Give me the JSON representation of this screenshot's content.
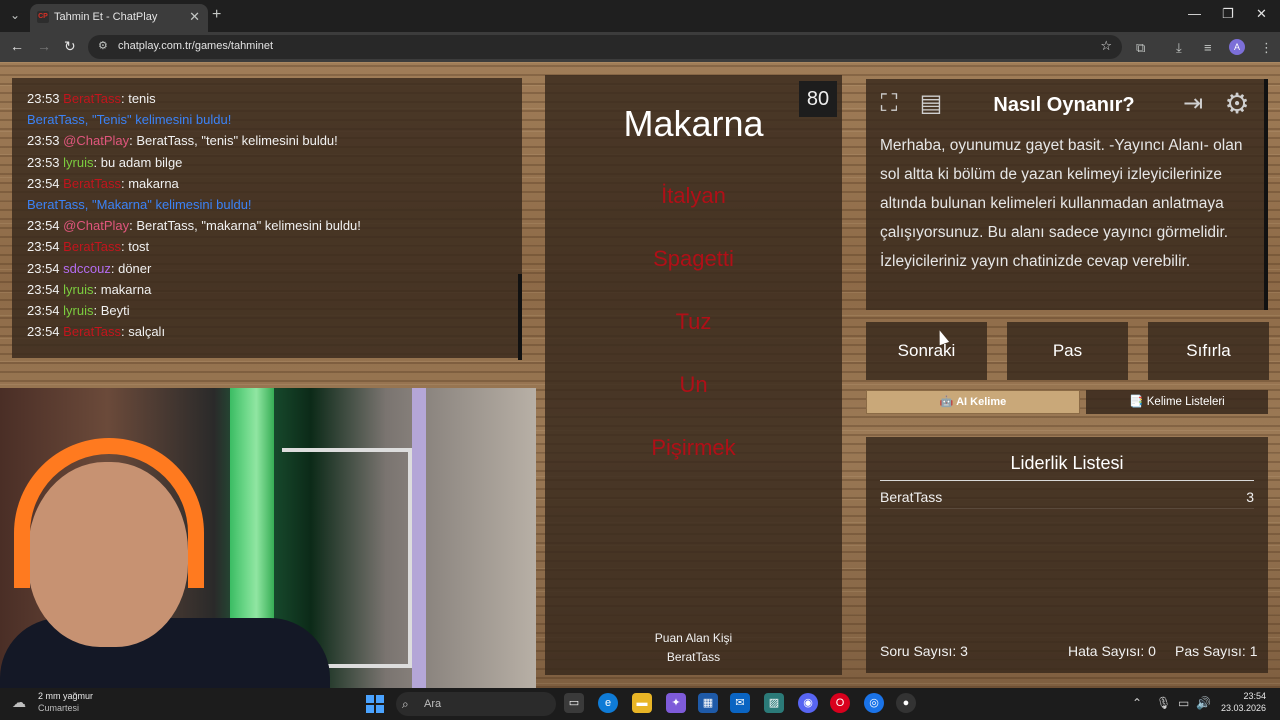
{
  "browser": {
    "tab_title": "Tahmin Et - ChatPlay",
    "tab_favicon": "CP",
    "url": "chatplay.com.tr/games/tahminet",
    "profile_initial": "A",
    "icons": [
      "tab-search-icon",
      "close-icon",
      "new-tab-icon",
      "minimize-icon",
      "maximize-icon",
      "window-close-icon",
      "back-icon",
      "forward-icon",
      "reload-icon",
      "site-info-icon",
      "bookmark-star-icon",
      "extensions-icon",
      "download-icon",
      "media-icon",
      "menu-icon"
    ]
  },
  "chat": {
    "messages": [
      {
        "time": "23:53",
        "user": "BeratTass",
        "user_color": "#c2151d",
        "text": ": tenis"
      },
      {
        "system": "BeratTass, \"Tenis\" kelimesini buldu!",
        "highlight": "\"Tenis\""
      },
      {
        "time": "23:53",
        "user": "@ChatPlay",
        "user_color": "#e0567d",
        "text": ": BeratTass, \"tenis\" kelimesini buldu!"
      },
      {
        "time": "23:53",
        "user": "lyruis",
        "user_color": "#7ccd3f",
        "text": ": bu adam bilge"
      },
      {
        "time": "23:54",
        "user": "BeratTass",
        "user_color": "#c2151d",
        "text": ": makarna"
      },
      {
        "system": "BeratTass, \"Makarna\" kelimesini buldu!",
        "highlight": "\"Makarna\""
      },
      {
        "time": "23:54",
        "user": "@ChatPlay",
        "user_color": "#e0567d",
        "text": ": BeratTass, \"makarna\" kelimesini buldu!"
      },
      {
        "time": "23:54",
        "user": "BeratTass",
        "user_color": "#c2151d",
        "text": ": tost"
      },
      {
        "time": "23:54",
        "user": "sdccouz",
        "user_color": "#b36cf0",
        "text": ": döner"
      },
      {
        "time": "23:54",
        "user": "lyruis",
        "user_color": "#7ccd3f",
        "text": ": makarna"
      },
      {
        "time": "23:54",
        "user": "lyruis",
        "user_color": "#7ccd3f",
        "text": ": Beyti"
      },
      {
        "time": "23:54",
        "user": "BeratTass",
        "user_color": "#c2151d",
        "text": ": salçalı"
      }
    ]
  },
  "card": {
    "word": "Makarna",
    "timer": "80",
    "taboo_words": [
      "İtalyan",
      "Spagetti",
      "Tuz",
      "Un",
      "Pişirmek"
    ],
    "scorer_label": "Puan Alan Kişi",
    "scorer_name": "BeratTass"
  },
  "howto": {
    "title": "Nasıl Oynanır?",
    "text": "Merhaba, oyunumuz gayet basit. -Yayıncı Alanı- olan sol altta ki bölüm de yazan kelimeyi izleyicilerinize altında bulunan kelimeleri kullanmadan anlatmaya çalışıyorsunuz. Bu alanı sadece yayıncı görmelidir. İzleyicileriniz yayın chatinizde cevap verebilir."
  },
  "controls": {
    "next": "Sonraki",
    "pass": "Pas",
    "reset": "Sıfırla",
    "ai_word": "🤖 AI Kelime",
    "word_lists": "📑 Kelime Listeleri"
  },
  "leaderboard": {
    "title": "Liderlik Listesi",
    "rows": [
      {
        "name": "BeratTass",
        "score": "3"
      }
    ],
    "question_count": "Soru Sayısı: 3",
    "error_count": "Hata Sayısı: 0",
    "pass_count": "Pas Sayısı: 1"
  },
  "taskbar": {
    "weather_line1": "2 mm yağmur",
    "weather_line2": "Cumartesi",
    "search_placeholder": "Ara",
    "time": "23:54",
    "date": "23.03.2026"
  },
  "colors": {
    "taboo_red": "#b00f17",
    "panel_bg": "#37281c",
    "ai_button": "#c9a879"
  }
}
